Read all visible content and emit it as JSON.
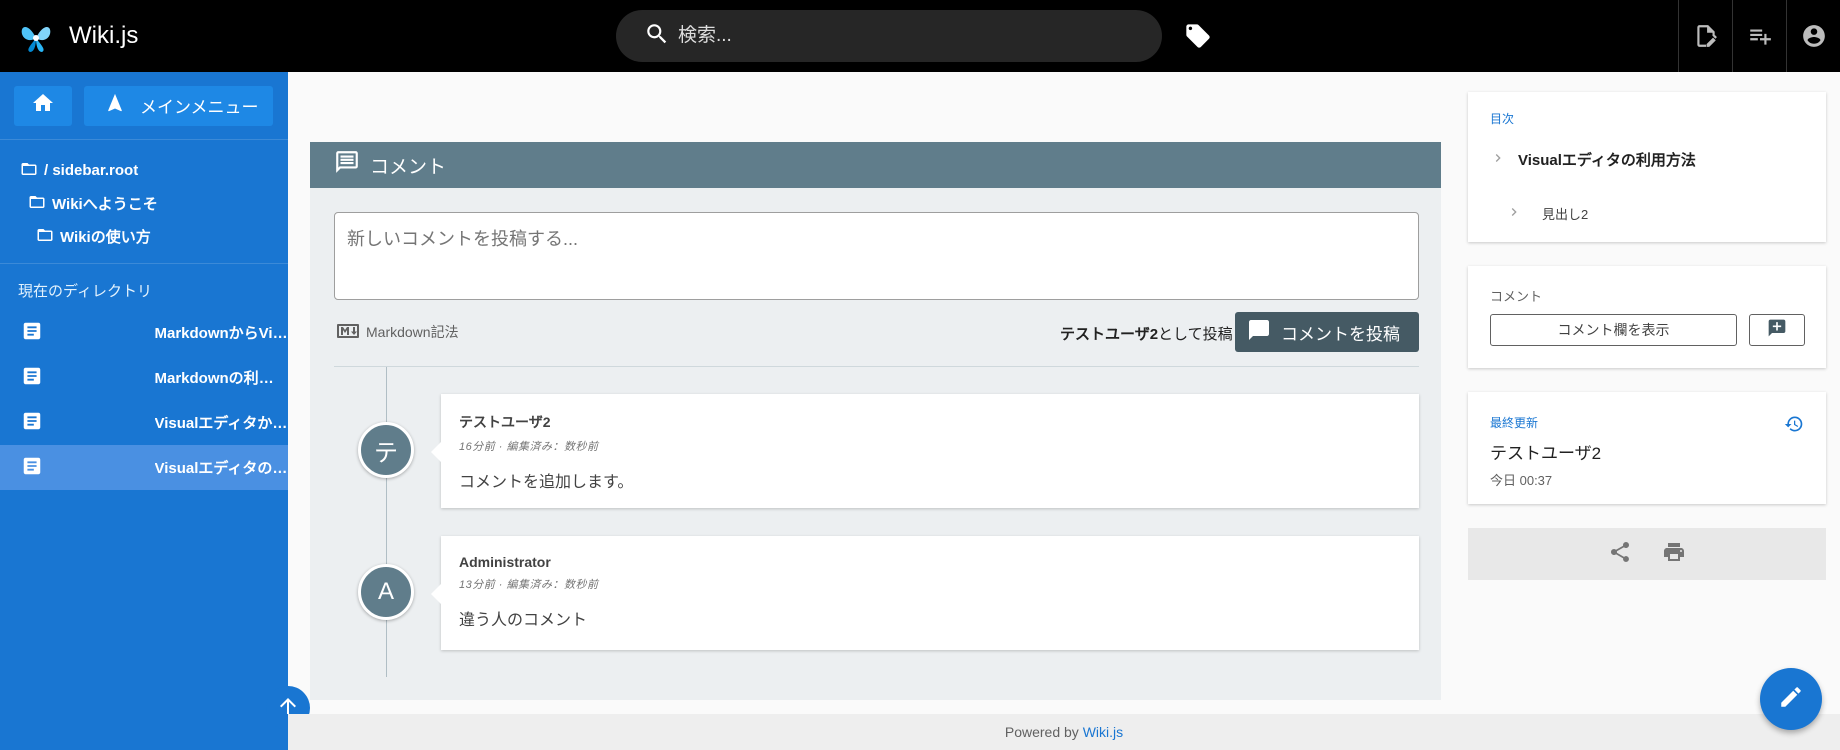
{
  "app": {
    "title": "Wiki.js"
  },
  "search": {
    "placeholder": "検索..."
  },
  "icons": {
    "logo": "wikijs-logo-icon",
    "search": "search-icon",
    "tags": "tags-icon",
    "new_page": "new-page-icon",
    "page_actions": "page-actions-icon",
    "account": "account-icon",
    "home": "home-icon",
    "menu": "navigation-icon",
    "folder": "folder-open-icon",
    "page": "page-icon",
    "comment": "comment-icon",
    "markdown": "markdown-icon",
    "history": "history-icon",
    "share": "share-icon",
    "print": "print-icon",
    "edit": "pencil-icon",
    "scroll_top": "arrow-up-icon"
  },
  "colors": {
    "topbar": "#000000",
    "sidebar": "#1976d2",
    "sidebar_active": "#4a90e2",
    "comments_header": "#607d8b",
    "post_button": "#455a64",
    "accent": "#1976d2"
  },
  "sidebar": {
    "menu_label": "メインメニュー",
    "tree": [
      {
        "label": "/ sidebar.root"
      },
      {
        "label": "Wikiへようこそ"
      },
      {
        "label": "Wikiの使い方"
      }
    ],
    "current_dir_label": "現在のディレクトリ",
    "pages": [
      {
        "label": "MarkdownからVirtual Editorへ"
      },
      {
        "label": "Markdownの利用方法"
      },
      {
        "label": "VisualエディタからMarkdownへ"
      },
      {
        "label": "Visualエディタの利用方法",
        "active": true
      }
    ]
  },
  "comments": {
    "header": "コメント",
    "textarea_placeholder": "新しいコメントを投稿する...",
    "markdown_hint": "Markdown記法",
    "post_as_user": "テストユーザ2",
    "post_as_suffix": "として投稿",
    "post_button": "コメントを投稿",
    "items": [
      {
        "avatar": "テ",
        "author": "テストユーザ2",
        "meta": "16分前 · 編集済み：数秒前",
        "body": "コメントを追加します。"
      },
      {
        "avatar": "A",
        "author": "Administrator",
        "meta": "13分前 · 編集済み：数秒前",
        "body": "違う人のコメント"
      }
    ]
  },
  "toc": {
    "title": "目次",
    "items": [
      {
        "label": "Visualエディタの利用方法"
      },
      {
        "label": "見出し2"
      }
    ]
  },
  "comment_panel": {
    "title": "コメント",
    "show_button": "コメント欄を表示"
  },
  "last_update": {
    "title": "最終更新",
    "user": "テストユーザ2",
    "time": "今日 00:37"
  },
  "footer": {
    "prefix": "Powered by",
    "link": "Wiki.js"
  }
}
